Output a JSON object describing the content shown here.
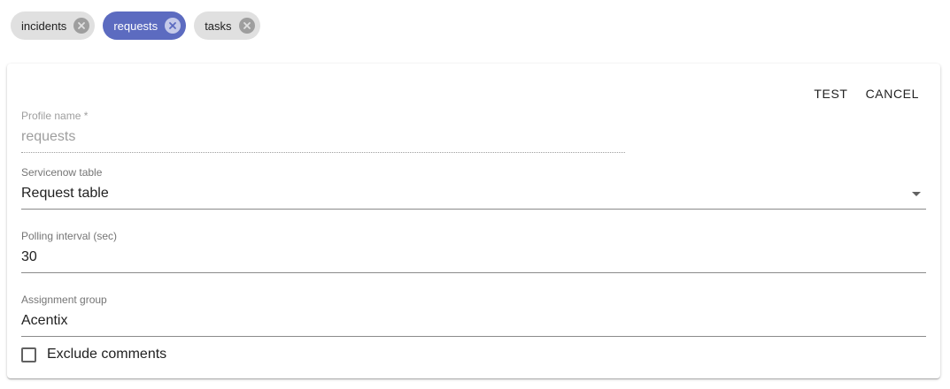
{
  "chips": [
    {
      "label": "incidents",
      "active": false
    },
    {
      "label": "requests",
      "active": true
    },
    {
      "label": "tasks",
      "active": false
    }
  ],
  "actions": {
    "test_label": "TEST",
    "cancel_label": "CANCEL"
  },
  "form": {
    "profile_name": {
      "label": "Profile name *",
      "value": "requests"
    },
    "servicenow_table": {
      "label": "Servicenow table",
      "value": "Request table"
    },
    "polling_interval": {
      "label": "Polling interval (sec)",
      "value": "30"
    },
    "assignment_group": {
      "label": "Assignment group",
      "value": "Acentix"
    },
    "exclude_comments": {
      "label": "Exclude comments",
      "checked": false
    }
  },
  "colors": {
    "accent": "#5c6bc0",
    "chip_bg": "#e0e0e0"
  },
  "icons": {
    "chip_close": "close-circle-icon",
    "dropdown": "arrow-drop-down-icon"
  }
}
